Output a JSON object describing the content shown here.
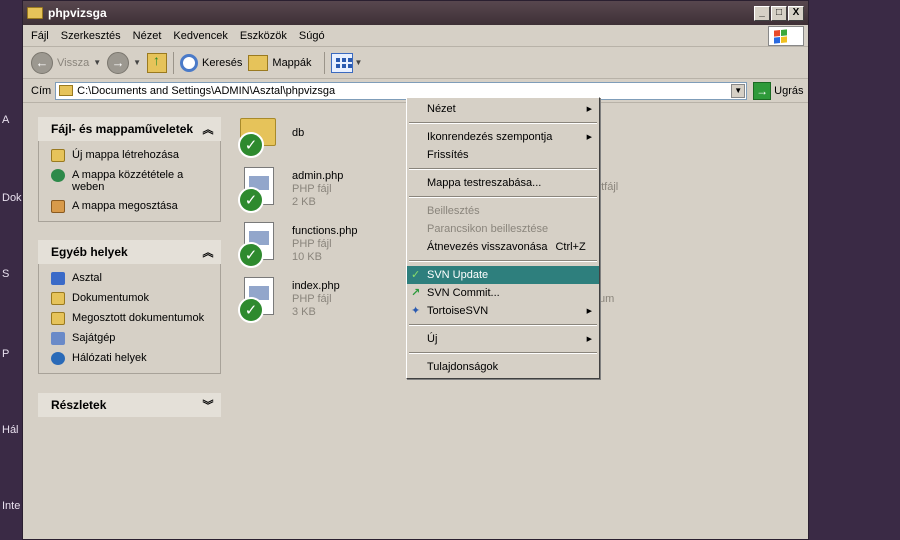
{
  "desktop": {
    "fragments": [
      "A",
      "Dok",
      "S",
      "P",
      "Hál",
      "Inte"
    ]
  },
  "window": {
    "title": "phpvizsga",
    "controls": {
      "minimize": "_",
      "maximize": "□",
      "close": "X"
    }
  },
  "menubar": {
    "items": [
      "Fájl",
      "Szerkesztés",
      "Nézet",
      "Kedvencek",
      "Eszközök",
      "Súgó"
    ]
  },
  "toolbar": {
    "back": "Vissza",
    "search": "Keresés",
    "folders": "Mappák"
  },
  "address": {
    "label": "Cím",
    "value": "C:\\Documents and Settings\\ADMIN\\Asztal\\phpvizsga",
    "go": "Ugrás"
  },
  "tasks": {
    "file_tasks": {
      "title": "Fájl- és mappaműveletek",
      "items": [
        "Új mappa létrehozása",
        "A mappa közzététele a weben",
        "A mappa megosztása"
      ]
    },
    "other_places": {
      "title": "Egyéb helyek",
      "items": [
        "Asztal",
        "Dokumentumok",
        "Megosztott dokumentumok",
        "Sajátgép",
        "Hálózati helyek"
      ]
    },
    "details": {
      "title": "Részletek"
    }
  },
  "files": [
    {
      "name": "db",
      "type": "",
      "size": ""
    },
    {
      "name": "admin.php",
      "type": "PHP fájl",
      "size": "2 KB"
    },
    {
      "name": "functions.php",
      "type": "PHP fájl",
      "size": "10 KB"
    },
    {
      "name": "index.php",
      "type": "PHP fájl",
      "size": "3 KB"
    }
  ],
  "behind_menu": {
    "text1": "etfájl",
    "text2": "um"
  },
  "context_menu": {
    "items": [
      {
        "label": "Nézet",
        "submenu": true
      },
      {
        "label": "Ikonrendezés szempontja",
        "submenu": true
      },
      {
        "label": "Frissítés"
      },
      {
        "label": "Mappa testreszabása..."
      },
      {
        "label": "Beillesztés",
        "disabled": true
      },
      {
        "label": "Parancsikon beillesztése",
        "disabled": true
      },
      {
        "label": "Átnevezés visszavonása",
        "shortcut": "Ctrl+Z"
      },
      {
        "label": "SVN Update",
        "highlighted": true
      },
      {
        "label": "SVN Commit..."
      },
      {
        "label": "TortoiseSVN",
        "submenu": true
      },
      {
        "label": "Új",
        "submenu": true
      },
      {
        "label": "Tulajdonságok"
      }
    ]
  },
  "colors": {
    "menu_highlight": "#2e7f7d",
    "svn_ok": "#2e8a2e"
  }
}
